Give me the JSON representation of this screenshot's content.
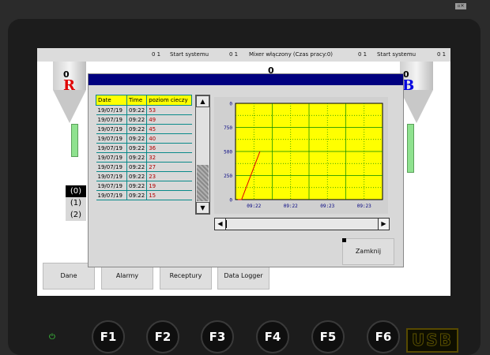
{
  "topbar": {
    "s1_bits": "0 1",
    "s1_label": "Start systemu",
    "s2_bits": "0 1",
    "s2_label": "Mixer włączony (Czas pracy:0)",
    "s3_bits": "0 1",
    "s3_label": "Start systemu",
    "s4_bits": "0 1"
  },
  "silos": {
    "left": {
      "value": "0",
      "letter": "R",
      "letter_color": "#e00000"
    },
    "mid": {
      "value": "0"
    },
    "right": {
      "value": "0",
      "letter": "B",
      "letter_color": "#0000e0"
    }
  },
  "states": [
    "(0)",
    "(1)",
    "(2)"
  ],
  "nav": {
    "dane": "Dane",
    "alarmy": "Alarmy",
    "receptury": "Receptury",
    "data_logger": "Data Logger"
  },
  "logger": {
    "headers": {
      "date": "Date",
      "time": "Time",
      "level": "poziom cieczy"
    },
    "rows": [
      {
        "date": "19/07/19",
        "time": "09:22",
        "value": "53"
      },
      {
        "date": "19/07/19",
        "time": "09:22",
        "value": "49"
      },
      {
        "date": "19/07/19",
        "time": "09:22",
        "value": "45"
      },
      {
        "date": "19/07/19",
        "time": "09:22",
        "value": "40"
      },
      {
        "date": "19/07/19",
        "time": "09:22",
        "value": "36"
      },
      {
        "date": "19/07/19",
        "time": "09:22",
        "value": "32"
      },
      {
        "date": "19/07/19",
        "time": "09:22",
        "value": "27"
      },
      {
        "date": "19/07/19",
        "time": "09:22",
        "value": "23"
      },
      {
        "date": "19/07/19",
        "time": "09:22",
        "value": "19"
      },
      {
        "date": "19/07/19",
        "time": "09:22",
        "value": "15"
      }
    ],
    "scroll_up": "▲",
    "scroll_down": "▼",
    "scroll_left": "◀",
    "scroll_right": "▶",
    "close": "Zamknij"
  },
  "chart_data": {
    "type": "line",
    "title": "",
    "xlabel": "",
    "ylabel": "",
    "x_ticks": [
      "09:22",
      "09:22",
      "09:23",
      "09:23"
    ],
    "y_ticks": [
      0,
      250,
      500,
      750,
      0
    ],
    "series": [
      {
        "values": [
          0,
          0,
          100,
          200,
          300,
          400,
          500
        ]
      }
    ],
    "plot_background": "#ffff00",
    "grid_color": "#008800",
    "line_color": "#e00000",
    "grid": true
  },
  "fkeys": [
    "F1",
    "F2",
    "F3",
    "F4",
    "F5",
    "F6"
  ],
  "power_icon": "power-icon",
  "usb_label": "USB",
  "colors": {
    "dialog_title": "#00007f",
    "table_header": "#ffff00",
    "value_red": "#b00000"
  }
}
